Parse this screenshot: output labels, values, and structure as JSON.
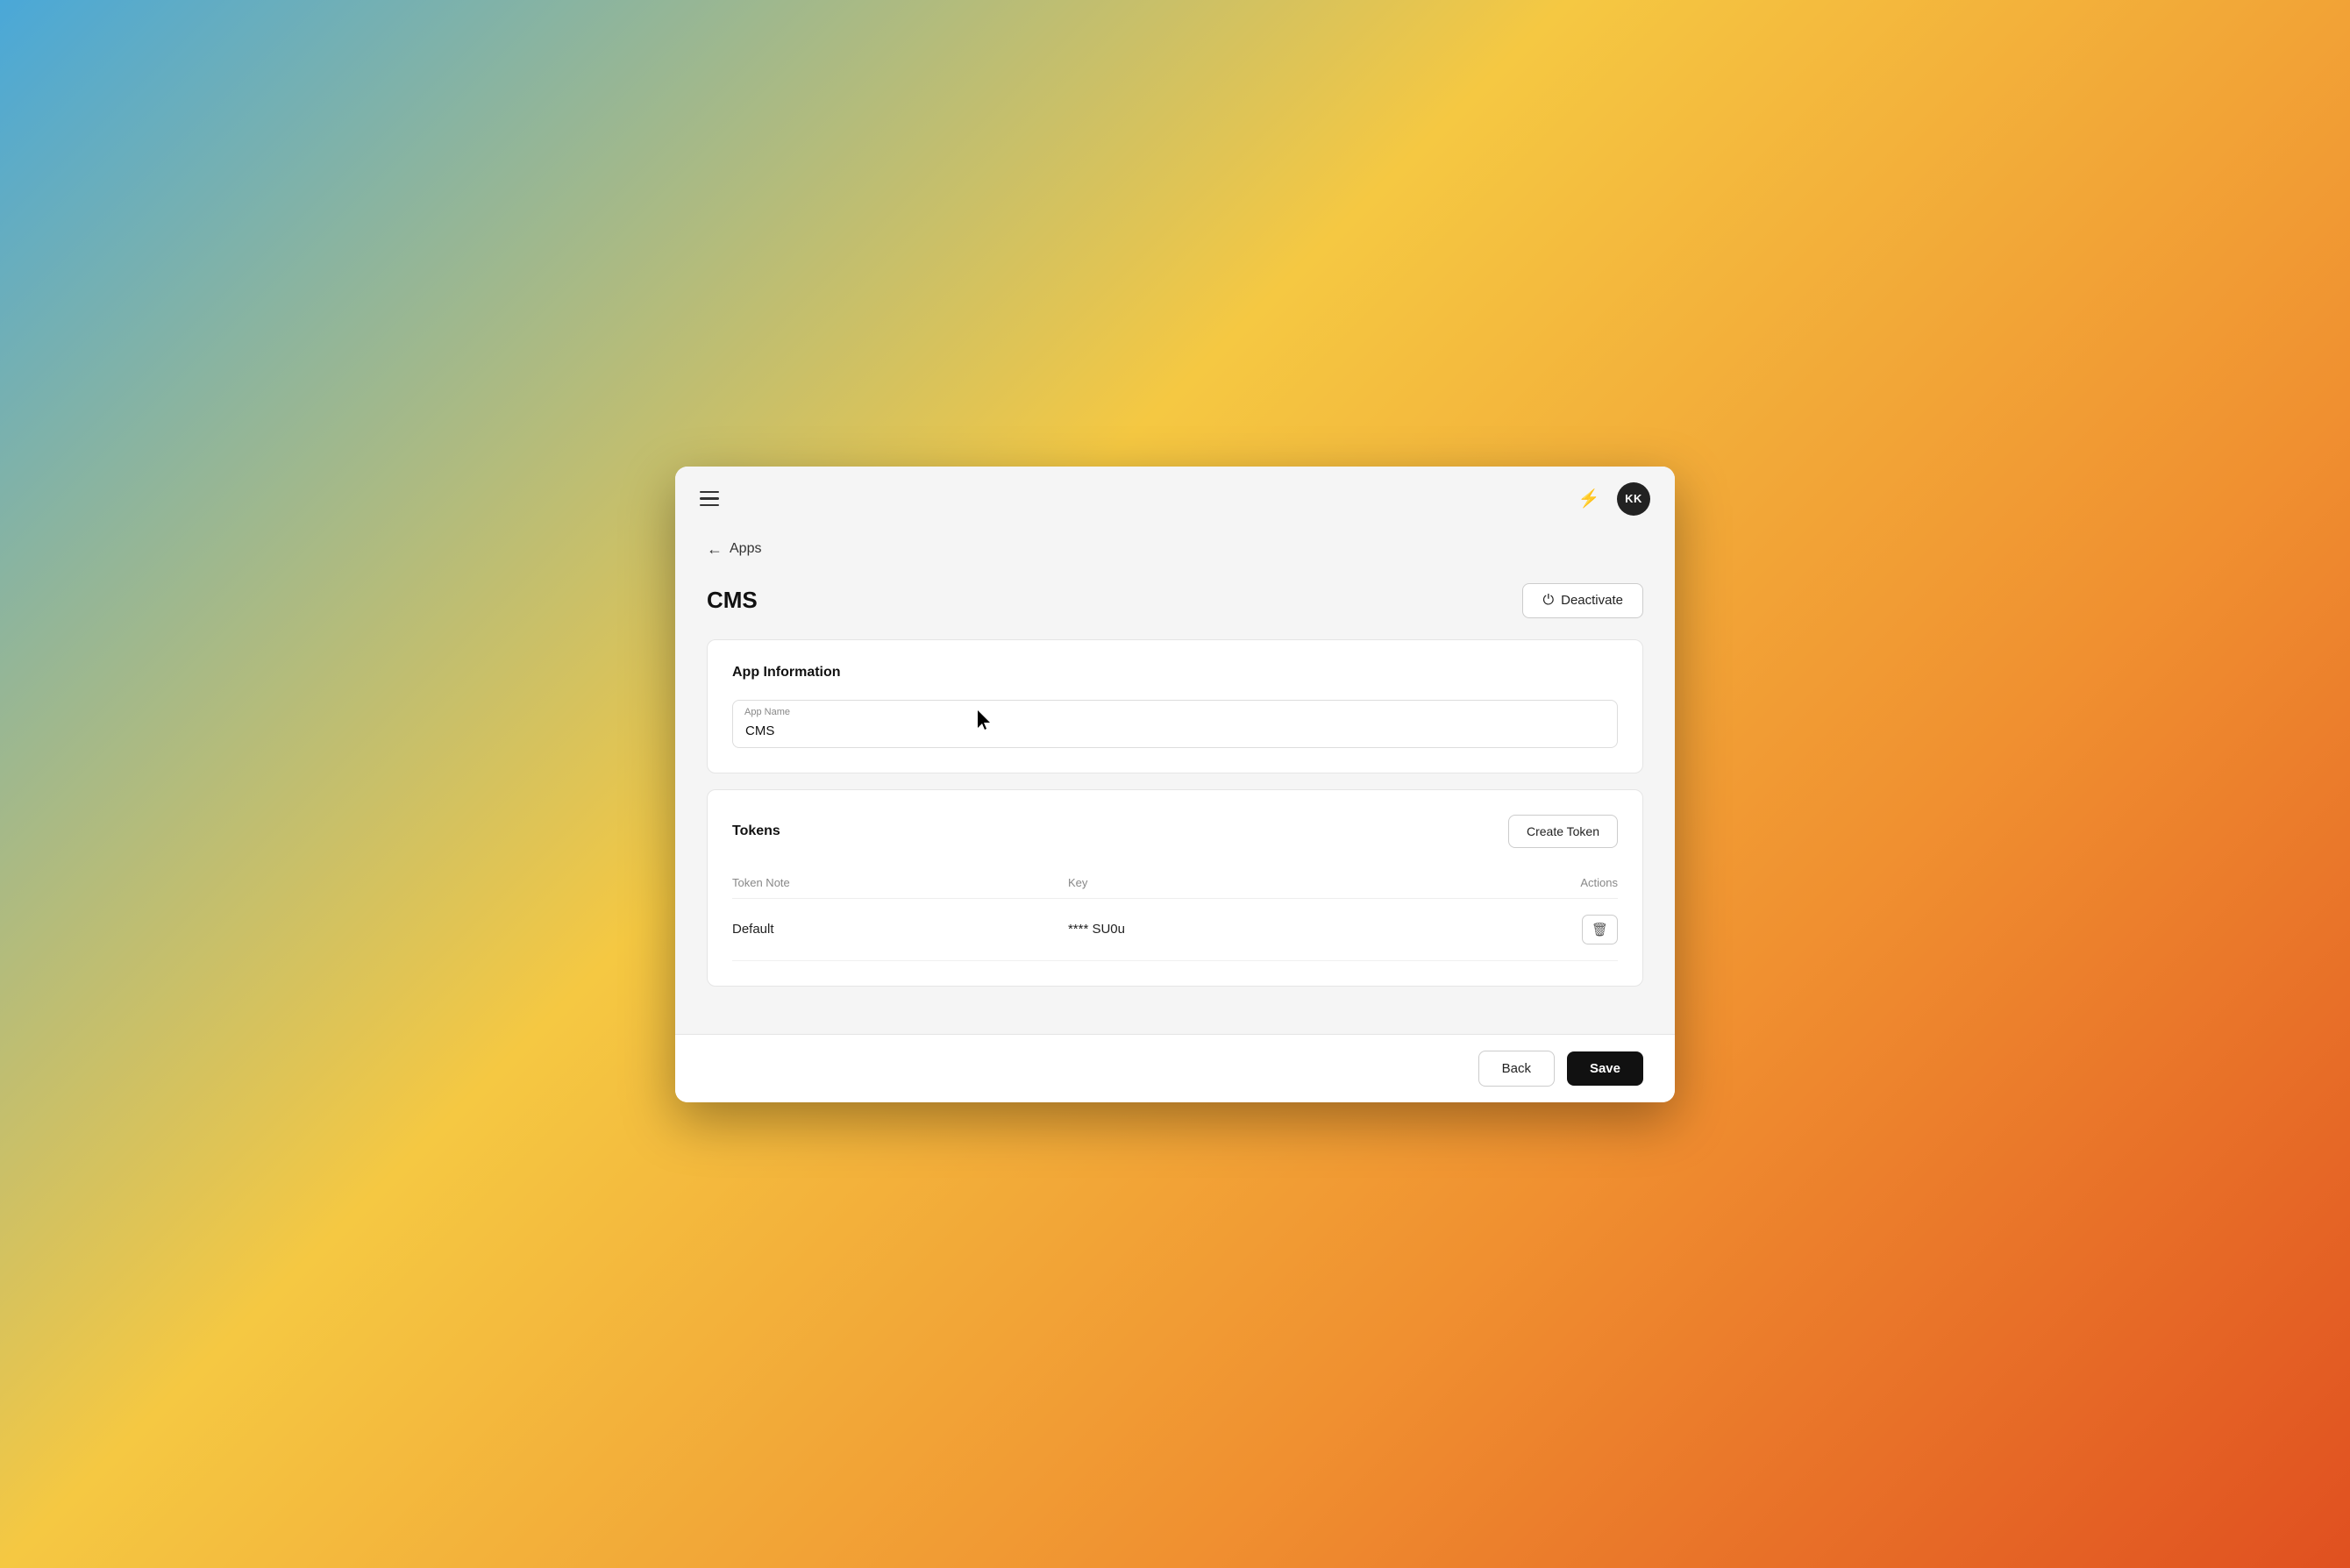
{
  "topbar": {
    "hamburger_label": "menu",
    "bolt_icon": "⚡",
    "avatar_initials": "KK"
  },
  "breadcrumb": {
    "back_label": "Apps",
    "back_arrow": "←"
  },
  "page": {
    "title": "CMS",
    "deactivate_label": "Deactivate"
  },
  "app_info": {
    "section_title": "App Information",
    "app_name_label": "App Name",
    "app_name_value": "CMS"
  },
  "tokens": {
    "section_title": "Tokens",
    "create_token_label": "Create Token",
    "table": {
      "col_note": "Token Note",
      "col_key": "Key",
      "col_actions": "Actions",
      "rows": [
        {
          "note": "Default",
          "key": "**** SU0u"
        }
      ]
    }
  },
  "footer": {
    "back_label": "Back",
    "save_label": "Save"
  }
}
